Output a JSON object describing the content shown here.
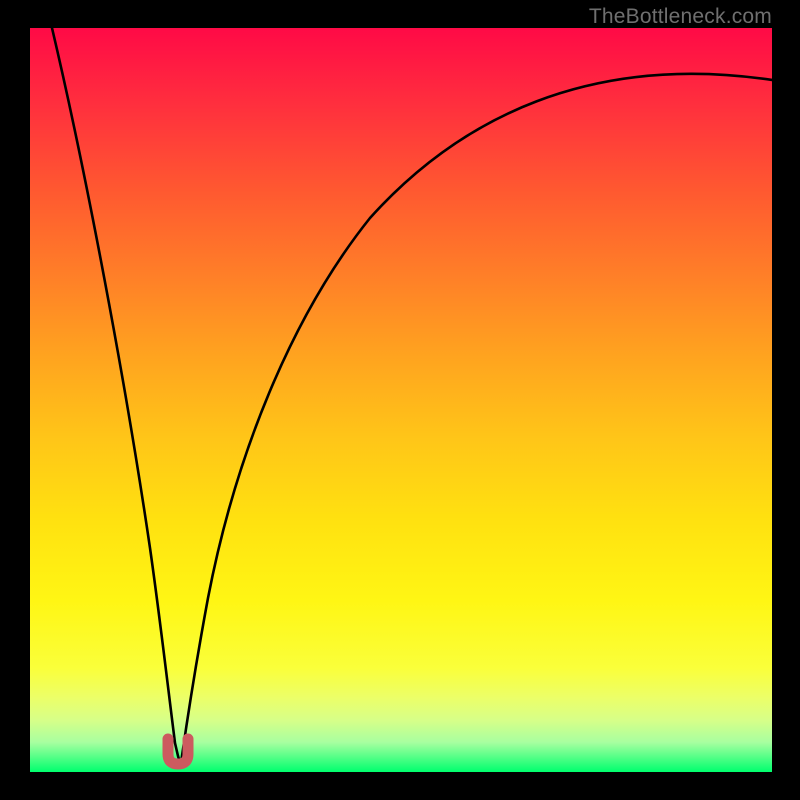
{
  "watermark": "TheBottleneck.com",
  "colors": {
    "frame": "#000000",
    "curve": "#000000",
    "marker": "#cc5a5f",
    "gradient_top": "#ff0a46",
    "gradient_bottom": "#00ff6e"
  },
  "chart_data": {
    "type": "line",
    "title": "",
    "xlabel": "",
    "ylabel": "",
    "xlim": [
      0,
      100
    ],
    "ylim": [
      0,
      100
    ],
    "grid": false,
    "legend": false,
    "series": [
      {
        "name": "bottleneck-curve",
        "color": "#000000",
        "x": [
          3,
          5,
          7,
          9,
          11,
          13,
          15,
          17,
          18,
          19,
          19.7,
          20.3,
          21,
          22,
          24,
          27,
          31,
          36,
          42,
          49,
          57,
          66,
          76,
          87,
          100
        ],
        "y": [
          100,
          88,
          76,
          65,
          54,
          43,
          32,
          20,
          11,
          5,
          2,
          2,
          5,
          12,
          24,
          36,
          47,
          56,
          64,
          71,
          77,
          82,
          86.5,
          90,
          93
        ]
      }
    ],
    "annotations": [
      {
        "name": "minimum-marker",
        "shape": "u",
        "color": "#cc5a5f",
        "x_range": [
          19.2,
          20.8
        ],
        "y_peak": 4
      }
    ]
  }
}
